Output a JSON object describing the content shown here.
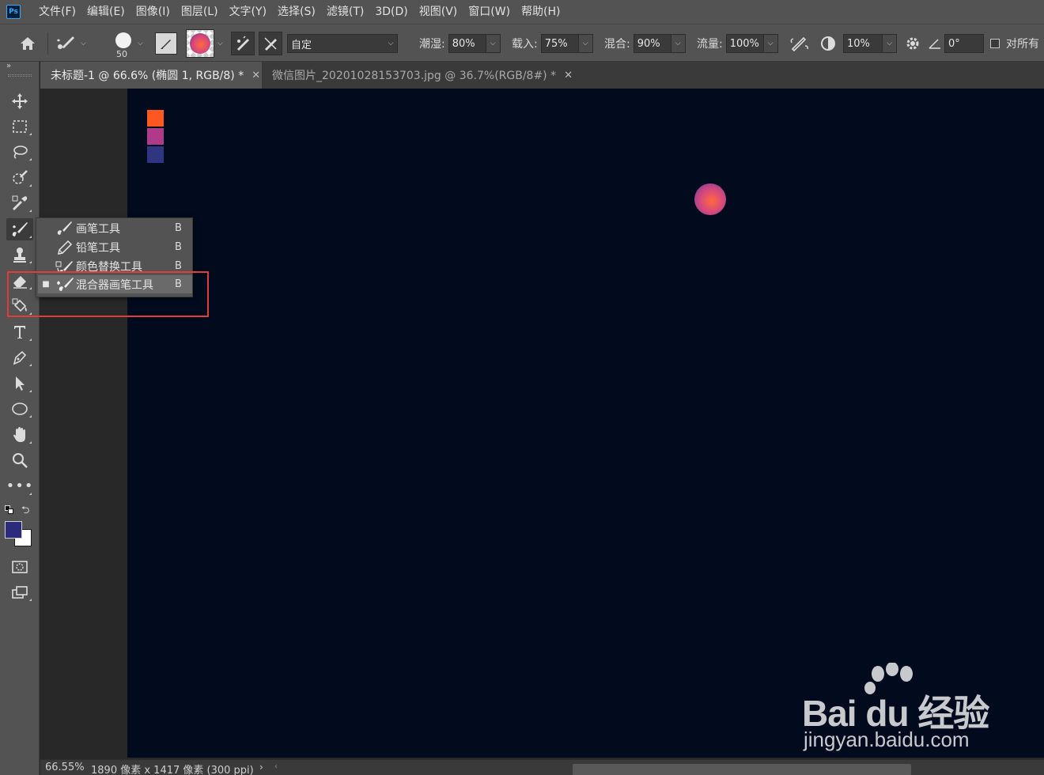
{
  "app": {
    "logo": "Ps",
    "accent_color": "#31a8ff"
  },
  "menubar": {
    "items": [
      "文件(F)",
      "编辑(E)",
      "图像(I)",
      "图层(L)",
      "文字(Y)",
      "选择(S)",
      "滤镜(T)",
      "3D(D)",
      "视图(V)",
      "窗口(W)",
      "帮助(H)"
    ]
  },
  "options": {
    "brush_size": "50",
    "preset_value": "自定",
    "wet_label": "潮湿:",
    "wet_value": "80%",
    "load_label": "载入:",
    "load_value": "75%",
    "mix_label": "混合:",
    "mix_value": "90%",
    "flow_label": "流量:",
    "flow_value": "100%",
    "smoothing_value": "10%",
    "angle_value": "0°",
    "sample_all_label": "对所有"
  },
  "tabs": [
    {
      "label": "未标题-1 @ 66.6% (椭圆 1, RGB/8) *",
      "active": true
    },
    {
      "label": "微信图片_20201028153703.jpg @ 36.7%(RGB/8#) *",
      "active": false
    }
  ],
  "canvas": {
    "background": "#020b1e",
    "swatches": [
      "#ff5722",
      "#b03a8a",
      "#2f3580"
    ]
  },
  "flyout": {
    "items": [
      {
        "label": "画笔工具",
        "key": "B",
        "icon": "brush-icon",
        "selected": false
      },
      {
        "label": "铅笔工具",
        "key": "B",
        "icon": "pencil-icon",
        "selected": false
      },
      {
        "label": "颜色替换工具",
        "key": "B",
        "icon": "color-replacement-icon",
        "selected": false
      },
      {
        "label": "混合器画笔工具",
        "key": "B",
        "icon": "mixer-brush-icon",
        "selected": true
      }
    ]
  },
  "colors": {
    "foreground": "#2c2a7a",
    "background": "#ffffff",
    "highlight": "#e33a3a"
  },
  "status": {
    "zoom": "66.55%",
    "doc_info": "1890 像素 x 1417 像素 (300 ppi)",
    "arrow": "›"
  },
  "watermark": {
    "brand": "Bai du 经验",
    "url": "jingyan.baidu.com"
  }
}
